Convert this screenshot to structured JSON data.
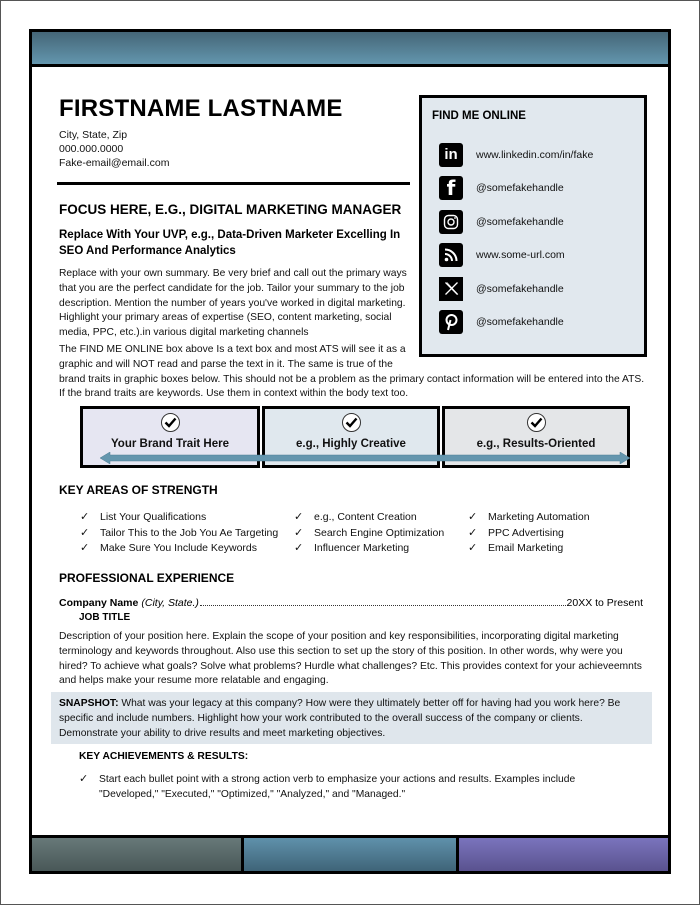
{
  "colors": {
    "header_bar": "#5482a0",
    "online_box_bg": "#e1e8ee",
    "trait_1_bg": "#e6e6f2",
    "trait_2_bg": "#e0e8ee",
    "trait_3_bg": "#e4e6e8",
    "arrow": "#6496ae",
    "snapshot_bg": "#dfe6ec",
    "footer_1": "#5a6a6a",
    "footer_2": "#52819a",
    "footer_3": "#6e67aa"
  },
  "header": {
    "name": "FIRSTNAME LASTNAME",
    "location": "City, State, Zip",
    "phone": "000.000.0000",
    "email": "Fake-email@email.com"
  },
  "online": {
    "title": "FIND ME ONLINE",
    "items": [
      {
        "icon": "linkedin-icon",
        "glyph": "in",
        "text": "www.linkedin.com/in/fake"
      },
      {
        "icon": "facebook-icon",
        "glyph": "f",
        "text": "@somefakehandle"
      },
      {
        "icon": "instagram-icon",
        "glyph": "◎",
        "text": "@somefakehandle"
      },
      {
        "icon": "rss-icon",
        "glyph": "◝",
        "text": "www.some-url.com"
      },
      {
        "icon": "x-twitter-icon",
        "glyph": "𝕏",
        "text": "@somefakehandle"
      },
      {
        "icon": "pinterest-icon",
        "glyph": "p",
        "text": "@somefakehandle"
      }
    ]
  },
  "focus": "FOCUS HERE, E.G., DIGITAL MARKETING MANAGER",
  "uvp": "Replace With Your UVP, e.g., Data-Driven Marketer Excelling In SEO And Performance Analytics",
  "summary": "Replace with your own summary. Be very brief and call out the primary ways that you are the perfect candidate for the job. Tailor your summary to the job description. Mention the number of years you've worked in digital marketing. Highlight your primary areas of expertise (SEO, content marketing, social media, PPC, etc.).in various digital marketing channels",
  "ats_note": {
    "part1": "The FIND ME ONLINE box above Is a text box and most ATS will see it as a graphic and will NOT read and parse the text in it. The same is true of the",
    "part2": "brand traits in graphic boxes below. This should not be a problem as the primary contact information will be entered into the ATS. If the brand traits are keywords. Use them in context within the body text too."
  },
  "brand_traits": [
    "Your Brand Trait Here",
    "e.g., Highly Creative",
    "e.g., Results-Oriented"
  ],
  "strengths": {
    "title": "KEY AREAS OF STRENGTH",
    "columns": [
      [
        "List Your Qualifications",
        "Tailor This to the Job You Ae Targeting",
        "Make Sure You Include Keywords"
      ],
      [
        "e.g., Content Creation",
        "Search Engine Optimization",
        "Influencer Marketing"
      ],
      [
        "Marketing Automation",
        "PPC Advertising",
        "Email Marketing"
      ]
    ]
  },
  "experience": {
    "title": "PROFESSIONAL EXPERIENCE",
    "company": "Company Name",
    "location": "(City, State.)",
    "dates": "20XX to Present",
    "job_title": "JOB TITLE",
    "description": "Description of your position here. Explain the scope of your position and key responsibilities, incorporating digital marketing terminology and keywords throughout. Also use this section to set up the story of this position. In other words, why were you hired? To achieve what goals? Solve what problems? Hurdle what challenges? Etc. This provides context for your achieveemnts and helps make your resume more relatable and engaging.",
    "snapshot_label": "SNAPSHOT:",
    "snapshot_text": " What was your legacy at this company? How were they ultimately better off for having had you work here? Be specific and include numbers. Highlight how your work contributed to the overall success of the company or clients. Demonstrate your ability to drive results and meet marketing objectives.",
    "achievements_title": "KEY ACHIEVEMENTS & RESULTS:",
    "achievements": [
      "Start each bullet point with a strong action verb to emphasize your actions and results. Examples include \"Developed,\" \"Executed,\" \"Optimized,\" \"Analyzed,\" and \"Managed.\""
    ]
  },
  "check_glyph": "✓"
}
